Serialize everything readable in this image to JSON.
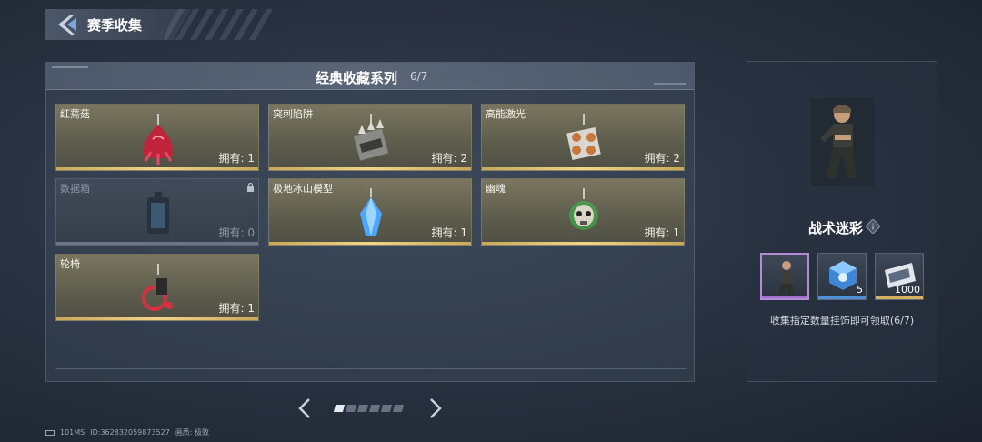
{
  "header": {
    "title": "赛季收集"
  },
  "panel": {
    "title": "经典收藏系列",
    "count": "6/7"
  },
  "cards": [
    {
      "name": "红蔫菇",
      "owned": "拥有: 1",
      "locked": false
    },
    {
      "name": "突刺陷阱",
      "owned": "拥有: 2",
      "locked": false
    },
    {
      "name": "高能激光",
      "owned": "拥有: 2",
      "locked": false
    },
    {
      "name": "数据箱",
      "owned": "拥有: 0",
      "locked": true
    },
    {
      "name": "极地冰山模型",
      "owned": "拥有: 1",
      "locked": false
    },
    {
      "name": "幽魂",
      "owned": "拥有: 1",
      "locked": false
    },
    {
      "name": "轮椅",
      "owned": "拥有: 1",
      "locked": false
    }
  ],
  "pager": {
    "pages": 6,
    "current": 1
  },
  "reward": {
    "name": "战术迷彩",
    "items": [
      {
        "qty": "",
        "rarity": "purple",
        "icon": "character-skin-icon"
      },
      {
        "qty": "5",
        "rarity": "blue",
        "icon": "crystal-box-icon"
      },
      {
        "qty": "1000",
        "rarity": "gold",
        "icon": "ticket-icon"
      }
    ],
    "hint": "收集指定数量挂饰即可领取(6/7)"
  },
  "footer": {
    "ping": "101MS",
    "id": "ID:362832059873527",
    "quality": "画质: 极致"
  },
  "colors": {
    "gold_bar": "#f2d58a",
    "purple": "#a070d0",
    "blue": "#4f8fd8"
  }
}
